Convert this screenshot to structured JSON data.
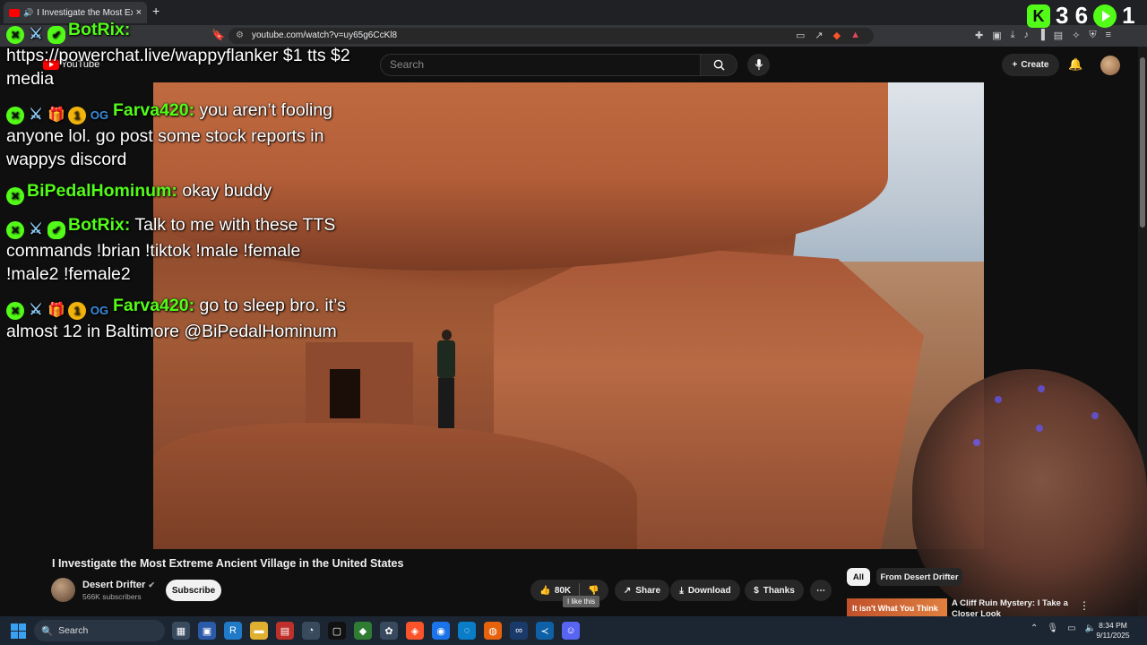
{
  "browser": {
    "tab_title": "I Investigate the Most Extreme",
    "tab_close": "×",
    "new_tab": "+",
    "url": "youtube.com/watch?v=uy65g6CcKl8"
  },
  "youtube": {
    "logo_text": "YouTube",
    "search_placeholder": "Search",
    "create_label": "Create"
  },
  "stream_overlay": {
    "viewer_count": "3 6",
    "follower_count": "1"
  },
  "chat": [
    {
      "badges": [
        "kick",
        "sword",
        "verified"
      ],
      "user": "BotRix:",
      "text": "https://powerchat.live/wappyflanker $1 tts $2 media"
    },
    {
      "badges": [
        "kick",
        "sword",
        "gift",
        "one",
        "og"
      ],
      "user": "Farva420:",
      "text": "you aren’t fooling anyone lol. go post some stock reports in wappys discord"
    },
    {
      "badges": [
        "kick"
      ],
      "user": "BiPedalHominum:",
      "text": "okay buddy"
    },
    {
      "badges": [
        "kick",
        "sword",
        "verified"
      ],
      "user": "BotRix:",
      "text": "Talk to me with these TTS commands !brian !tiktok !male !female !male2 !female2"
    },
    {
      "badges": [
        "kick",
        "sword",
        "gift",
        "one",
        "og"
      ],
      "user": "Farva420:",
      "text": "go to sleep bro. it’s almost 12 in Baltimore @BiPedalHominum"
    }
  ],
  "video": {
    "title": "I Investigate the Most Extreme Ancient Village in the United States",
    "channel_name": "Desert Drifter",
    "subscribers": "566K subscribers",
    "subscribe_label": "Subscribe",
    "likes": "80K",
    "like_tooltip": "I like this",
    "share_label": "Share",
    "download_label": "Download",
    "thanks_label": "Thanks",
    "more_label": "⋯"
  },
  "recommendations": {
    "chips": [
      "All",
      "From Desert Drifter"
    ],
    "items": [
      {
        "thumb_text": "It isn't What You Think",
        "title": "A Cliff Ruin Mystery: I Take a Closer Look"
      }
    ]
  },
  "taskbar": {
    "search_label": "Search",
    "time": "8:34 PM",
    "date": "9/11/2025"
  },
  "colors": {
    "kick_green": "#53fc18",
    "yt_red": "#ff0000",
    "background": "#0f0f0f"
  }
}
